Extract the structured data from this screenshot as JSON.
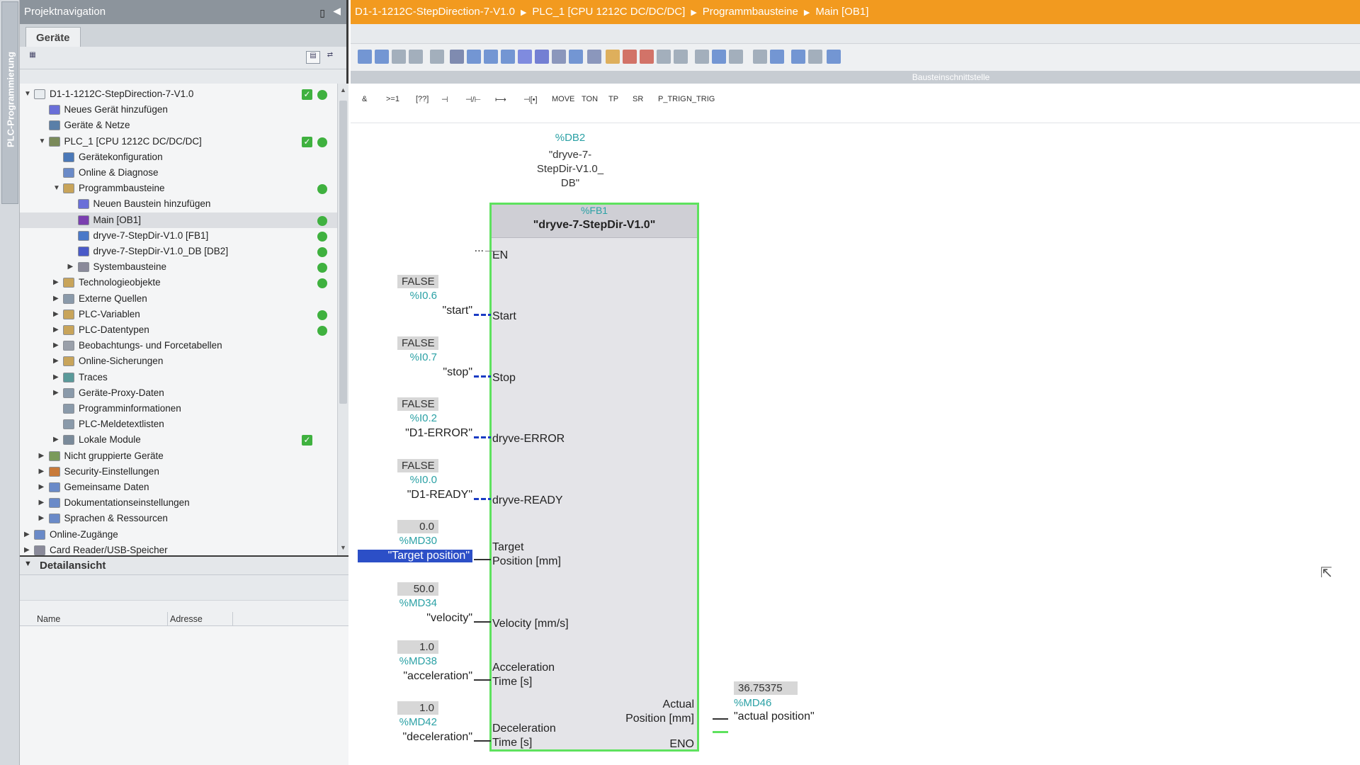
{
  "side_strip": {
    "label": "PLC-Programmierung"
  },
  "project_navigation": {
    "title": "Projektnavigation",
    "tab": "Geräte",
    "tree": [
      {
        "label": "D1-1-1212C-StepDirection-7-V1.0",
        "check": true,
        "dot": true
      },
      {
        "label": "Neues Gerät hinzufügen"
      },
      {
        "label": "Geräte & Netze"
      },
      {
        "label": "PLC_1 [CPU 1212C DC/DC/DC]",
        "check": true,
        "dot": true
      },
      {
        "label": "Gerätekonfiguration"
      },
      {
        "label": "Online & Diagnose"
      },
      {
        "label": "Programmbausteine",
        "dot": true
      },
      {
        "label": "Neuen Baustein hinzufügen"
      },
      {
        "label": "Main [OB1]",
        "dot": true
      },
      {
        "label": "dryve-7-StepDir-V1.0 [FB1]",
        "dot": true
      },
      {
        "label": "dryve-7-StepDir-V1.0_DB [DB2]",
        "dot": true
      },
      {
        "label": "Systembausteine",
        "dot": true
      },
      {
        "label": "Technologieobjekte",
        "dot": true
      },
      {
        "label": "Externe Quellen"
      },
      {
        "label": "PLC-Variablen",
        "dot": true
      },
      {
        "label": "PLC-Datentypen",
        "dot": true
      },
      {
        "label": "Beobachtungs- und Forcetabellen"
      },
      {
        "label": "Online-Sicherungen"
      },
      {
        "label": "Traces"
      },
      {
        "label": "Geräte-Proxy-Daten"
      },
      {
        "label": "Programminformationen"
      },
      {
        "label": "PLC-Meldetextlisten"
      },
      {
        "label": "Lokale Module",
        "check": true
      },
      {
        "label": "Nicht gruppierte Geräte"
      },
      {
        "label": "Security-Einstellungen"
      },
      {
        "label": "Gemeinsame Daten"
      },
      {
        "label": "Dokumentationseinstellungen"
      },
      {
        "label": "Sprachen & Ressourcen"
      },
      {
        "label": "Online-Zugänge"
      },
      {
        "label": "Card Reader/USB-Speicher"
      }
    ]
  },
  "detail_view": {
    "title": "Detailansicht",
    "columns": [
      "Name",
      "Adresse"
    ]
  },
  "breadcrumb": [
    "D1-1-1212C-StepDirection-7-V1.0",
    "PLC_1 [CPU 1212C DC/DC/DC]",
    "Programmbausteine",
    "Main [OB1]"
  ],
  "interface_bar": "Bausteinschnittstelle",
  "ladder_instructions": [
    "&",
    ">=1",
    "[??]",
    "⊣",
    "⊣/⊢",
    "⟼",
    "⊣[•]",
    "MOVE",
    "TON",
    "TP",
    "SR",
    "P_TRIG",
    "N_TRIG"
  ],
  "fb_block": {
    "db_address": "%DB2",
    "db_name_line1": "\"dryve-7-",
    "db_name_line2": "StepDir-V1.0_",
    "db_name_line3": "DB\"",
    "fb_number": "%FB1",
    "fb_name": "\"dryve-7-StepDir-V1.0\"",
    "en_label": "EN",
    "en_input": "...",
    "eno_label": "ENO",
    "inputs": [
      {
        "pin": "Start",
        "value": "FALSE",
        "address": "%I0.6",
        "symbol": "\"start\""
      },
      {
        "pin": "Stop",
        "value": "FALSE",
        "address": "%I0.7",
        "symbol": "\"stop\""
      },
      {
        "pin": "dryve-ERROR",
        "value": "FALSE",
        "address": "%I0.2",
        "symbol": "\"D1-ERROR\""
      },
      {
        "pin": "dryve-READY",
        "value": "FALSE",
        "address": "%I0.0",
        "symbol": "\"D1-READY\""
      },
      {
        "pin1": "Target",
        "pin2": "Position [mm]",
        "value": "0.0",
        "address": "%MD30",
        "symbol": "\"Target position\""
      },
      {
        "pin": "Velocity [mm/s]",
        "value": "50.0",
        "address": "%MD34",
        "symbol": "\"velocity\""
      },
      {
        "pin1": "Acceleration",
        "pin2": "Time [s]",
        "value": "1.0",
        "address": "%MD38",
        "symbol": "\"acceleration\""
      },
      {
        "pin1": "Deceleration",
        "pin2": "Time [s]",
        "value": "1.0",
        "address": "%MD42",
        "symbol": "\"deceleration\""
      }
    ],
    "output": {
      "pin1": "Actual",
      "pin2": "Position [mm]",
      "value": "36.75375",
      "address": "%MD46",
      "symbol": "\"actual position\""
    }
  },
  "colors": {
    "breadcrumb_bg": "#f29a1f",
    "block_border": "#5ee25e",
    "address_teal": "#2ba1a5",
    "status_green": "#3fb13f",
    "selection_blue": "#2c4fc7"
  }
}
